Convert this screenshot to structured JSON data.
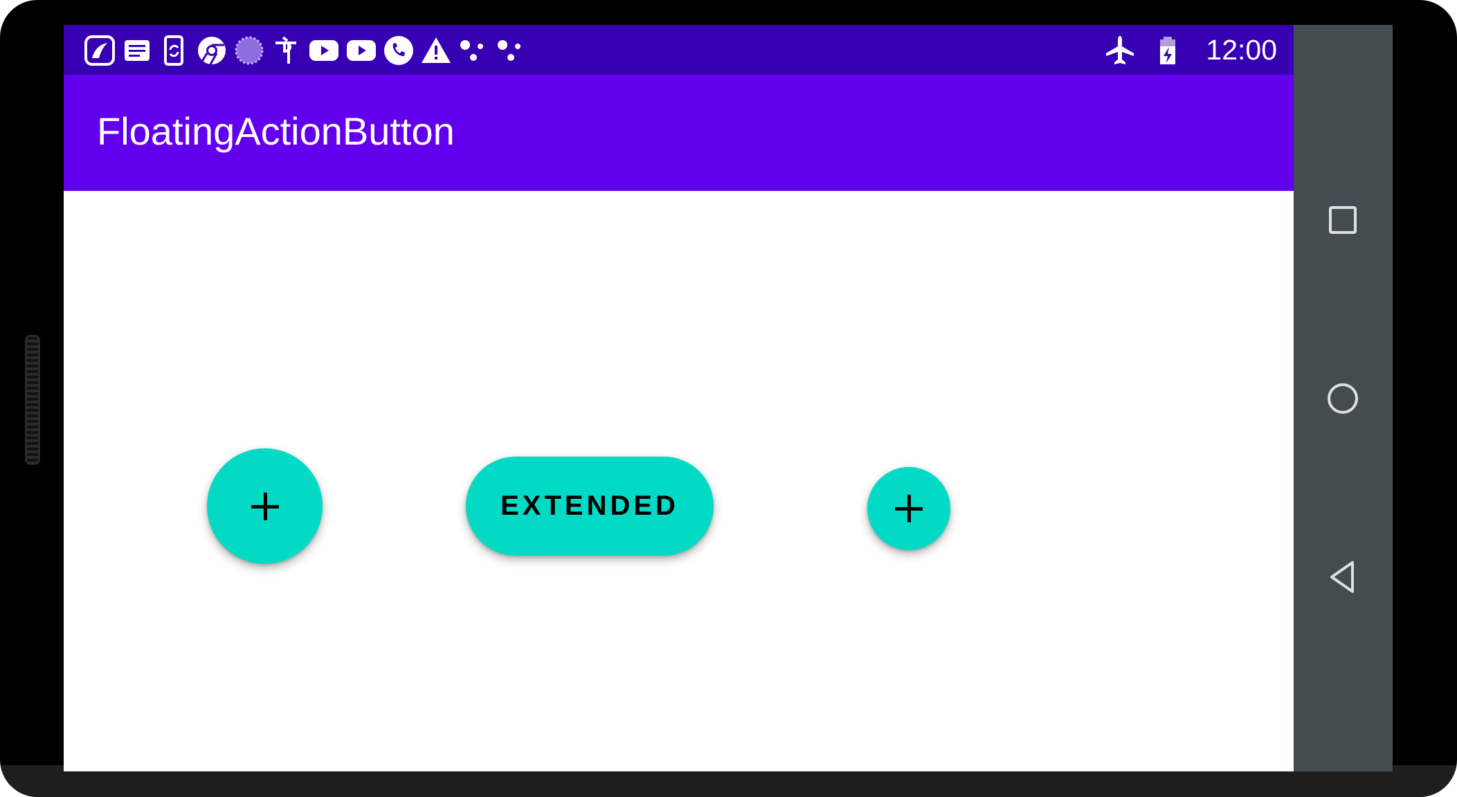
{
  "status_bar": {
    "time": "12:00",
    "left_icons": [
      "saavn-icon",
      "news-icon",
      "phone-sync-icon",
      "chrome-icon",
      "loading-circle-icon",
      "phonepe-icon",
      "youtube-icon",
      "youtube-icon",
      "phone-call-icon",
      "warning-icon",
      "dots-icon",
      "dots-icon"
    ],
    "right_icons": [
      "airplane-icon",
      "battery-charging-icon"
    ]
  },
  "app_bar": {
    "title": "FloatingActionButton"
  },
  "content": {
    "fab_normal": {
      "icon": "plus-icon"
    },
    "fab_extended": {
      "label": "EXTENDED"
    },
    "fab_mini": {
      "icon": "plus-icon"
    }
  },
  "nav_bar": {
    "buttons": [
      "recents-square-icon",
      "home-circle-icon",
      "back-triangle-icon"
    ]
  },
  "colors": {
    "status_bar": "#3700B3",
    "app_bar": "#6200EE",
    "fab": "#03DAC5",
    "nav_bar": "#434C51"
  }
}
